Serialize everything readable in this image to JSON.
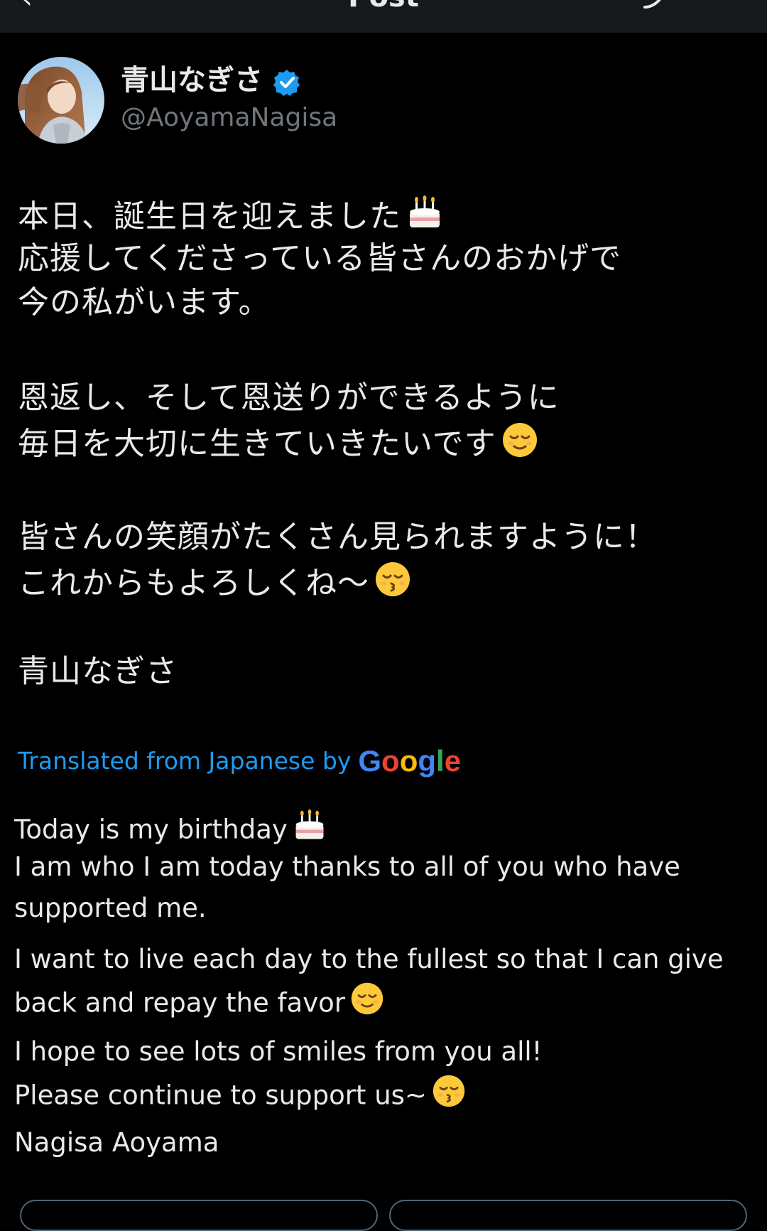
{
  "nav": {
    "back_icon": "back-arrow-icon",
    "title": "Post",
    "reply_icon": "reply-icon"
  },
  "post": {
    "author": {
      "name": "青山なぎさ",
      "handle": "@AoyamaNagisa",
      "verified": true,
      "verified_color": "#1d9bf0"
    },
    "original_lines": [
      "本日、誕生日を迎えました",
      "応援してくださっている皆さんのおかげで",
      "今の私がいます。",
      "恩返し、そして恩送りができるように",
      "毎日を大切に生きていきたいです",
      "皆さんの笑顔がたくさん見られますように！",
      "これからもよろしくね〜",
      "青山なぎさ"
    ],
    "translation": {
      "label": "Translated from Japanese by",
      "provider": "Google",
      "lines": [
        "Today is my birthday",
        "I am who I am today thanks to all of you who have",
        "supported me.",
        "I want to live each day to the fullest so that I can give",
        "back and repay the favor",
        "I hope to see lots of smiles from you all!",
        "Please continue to support us~",
        "Nagisa Aoyama"
      ]
    }
  },
  "colors": {
    "background": "#000000",
    "text": "#e7e9ea",
    "muted": "#71767b",
    "link": "#1d9bf0"
  }
}
